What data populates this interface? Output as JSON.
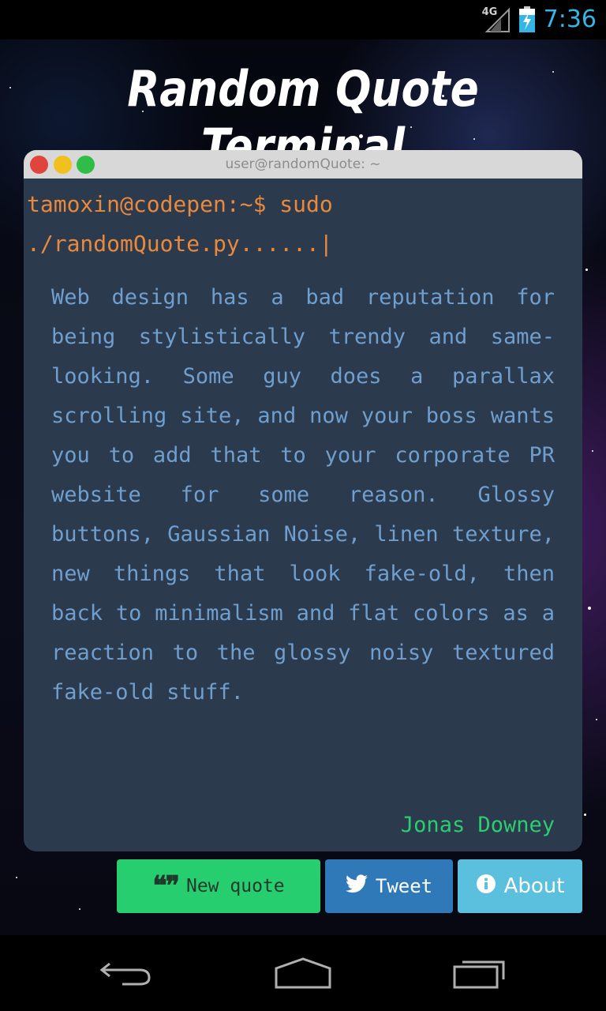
{
  "status_bar": {
    "network": "4G",
    "time": "7:36",
    "colors": {
      "clock": "#33b5e5",
      "battery": "#33b5e5"
    }
  },
  "app": {
    "title": "Random Quote Terminal"
  },
  "terminal": {
    "window_title": "user@randomQuote: ~",
    "prompt": "tamoxin@codepen:~$ sudo ./randomQuote.py......",
    "cursor": "|",
    "quote_text": "Web design has a bad reputation for being stylistically trendy and same-looking. Some guy does a parallax scrolling site, and now your boss wants you to add that to your corporate PR website for some reason. Glossy buttons, Gaussian Noise, linen texture, new things that look fake-old, then back to minimalism and flat colors as a reaction to the glossy noisy textured fake-old stuff.",
    "author": "Jonas Downey",
    "colors": {
      "background": "#2c3a4e",
      "prompt": "#e8893d",
      "quote": "#6e9fce",
      "author": "#2ecc71"
    }
  },
  "buttons": {
    "new_quote": {
      "label": "New quote",
      "icon": "quote-icon",
      "color": "#27ce70"
    },
    "tweet": {
      "label": "Tweet",
      "icon": "twitter-icon",
      "color": "#2f79b9"
    },
    "about": {
      "label": "About",
      "icon": "info-icon",
      "color": "#5bc0de"
    }
  },
  "nav_bar": {
    "items": [
      "back-icon",
      "home-icon",
      "recent-apps-icon"
    ]
  }
}
